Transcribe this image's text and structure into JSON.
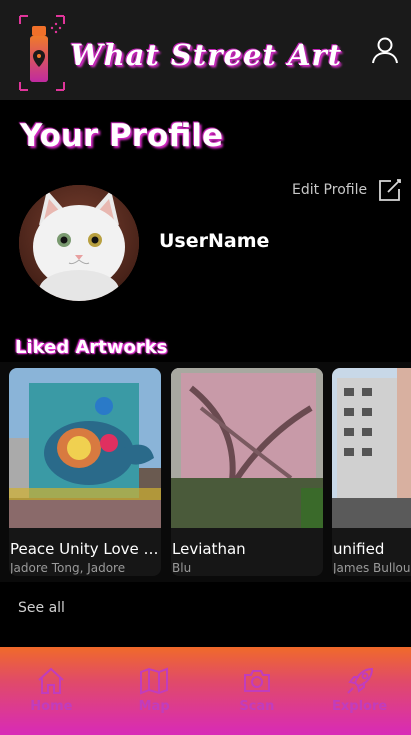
{
  "header": {
    "app_title": "What Street Art"
  },
  "profile": {
    "title": "Your Profile",
    "username": "UserName",
    "edit_label": "Edit Profile"
  },
  "liked": {
    "title": "Liked Artworks",
    "see_all": "See all",
    "items": [
      {
        "title": "Peace Unity Love W...",
        "artist": "Jadore Tong, Jadore"
      },
      {
        "title": "Leviathan",
        "artist": "Blu"
      },
      {
        "title": "unified",
        "artist": "James Bullough"
      }
    ]
  },
  "nav": {
    "items": [
      {
        "label": "Home",
        "icon": "home-icon"
      },
      {
        "label": "Map",
        "icon": "map-icon"
      },
      {
        "label": "Scan",
        "icon": "camera-icon"
      },
      {
        "label": "Explore",
        "icon": "rocket-icon"
      }
    ]
  },
  "colors": {
    "accent_pink": "#d92bc9",
    "nav_gradient_top": "#f06a2a",
    "nav_gradient_bottom": "#d82ab8",
    "header_bg": "#1a1a1a"
  }
}
